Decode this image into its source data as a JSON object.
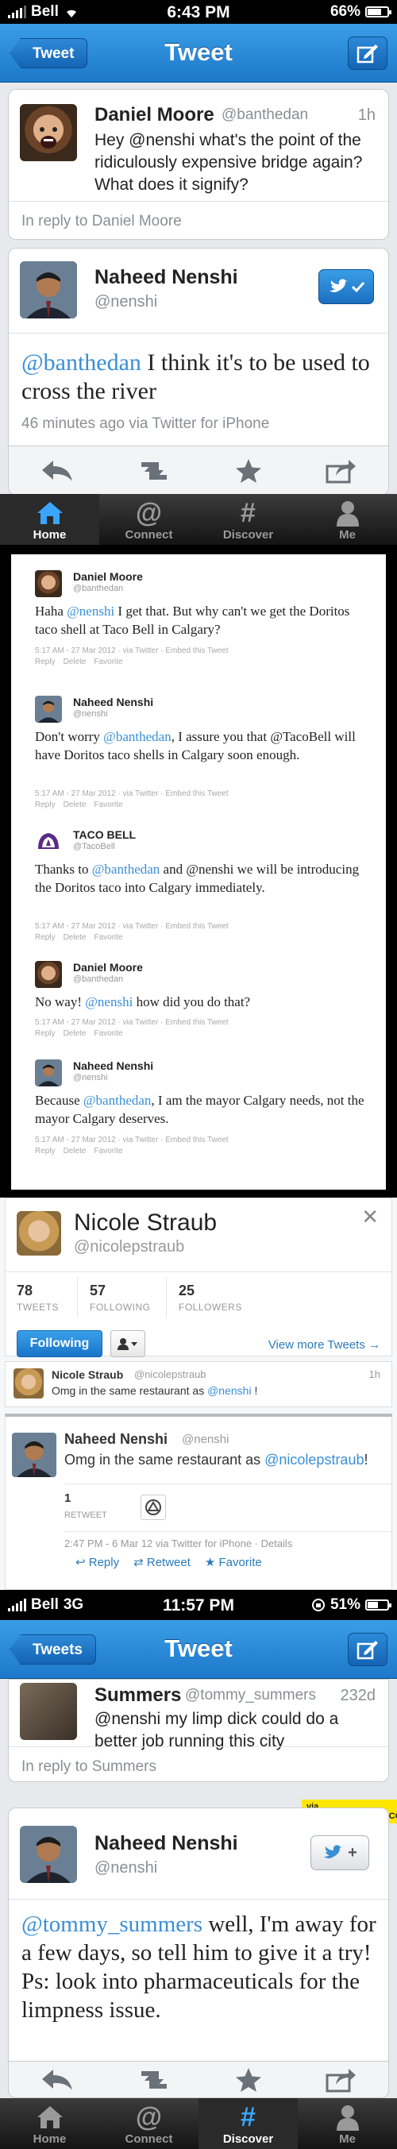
{
  "panel1": {
    "status": {
      "carrier": "Bell",
      "time": "6:43 PM",
      "battery": "66%"
    },
    "nav": {
      "back": "Tweet",
      "title": "Tweet"
    },
    "original": {
      "name": "Daniel Moore",
      "handle": "@banthedan",
      "age": "1h",
      "text": "Hey @nenshi what's the point of the ridiculously expensive bridge again? What does it signify?",
      "in_reply_to": "In reply to Daniel Moore"
    },
    "reply": {
      "name": "Naheed Nenshi",
      "handle": "@nenshi",
      "mention": "@banthedan",
      "text": " I think it's to be used to cross the river",
      "meta": "46 minutes ago via Twitter for iPhone"
    },
    "tabs": [
      {
        "label": "Home",
        "icon": "home-icon"
      },
      {
        "label": "Connect",
        "icon": "at-icon"
      },
      {
        "label": "Discover",
        "icon": "hash-icon"
      },
      {
        "label": "Me",
        "icon": "person-icon"
      }
    ]
  },
  "panel2": {
    "tweets": [
      {
        "name": "Daniel Moore",
        "handle": "@banthedan",
        "pre": "Haha ",
        "mention": "@nenshi",
        "post": " I get that. But why can't we get the Doritos taco shell at Taco Bell in Calgary?",
        "meta": "5:17 AM - 27 Mar 2012 · via Twitter · Embed this Tweet",
        "actions": [
          "Reply",
          "Delete",
          "Favorite"
        ]
      },
      {
        "name": "Naheed Nenshi",
        "handle": "@nenshi",
        "pre": "Don't worry ",
        "mention": "@banthedan",
        "post": ", I assure you that @TacoBell will have Doritos taco shells in Calgary soon enough.",
        "meta": "5:17 AM - 27 Mar 2012 · via Twitter · Embed this Tweet",
        "actions": [
          "Reply",
          "Delete",
          "Favorite"
        ]
      },
      {
        "name": "TACO BELL",
        "handle": "@TacoBell",
        "pre": "Thanks to ",
        "mention": "@banthedan",
        "post": " and @nenshi we will be introducing the Doritos taco into Calgary immediately.",
        "meta": "5:17 AM - 27 Mar 2012 · via Twitter · Embed this Tweet",
        "actions": [
          "Reply",
          "Delete",
          "Favorite"
        ]
      },
      {
        "name": "Daniel Moore",
        "handle": "@banthedan",
        "pre": "No way! ",
        "mention": "@nenshi",
        "post": " how did you do that?",
        "meta": "5:17 AM - 27 Mar 2012 · via Twitter · Embed this Tweet",
        "actions": [
          "Reply",
          "Delete",
          "Favorite"
        ]
      },
      {
        "name": "Naheed Nenshi",
        "handle": "@nenshi",
        "pre": "Because ",
        "mention": "@banthedan",
        "post": ", I am the mayor Calgary needs, not the mayor Calgary deserves.",
        "meta": "5:17 AM - 27 Mar 2012 · via Twitter · Embed this Tweet",
        "actions": [
          "Reply",
          "Delete",
          "Favorite"
        ]
      }
    ]
  },
  "panel3": {
    "name": "Nicole Straub",
    "handle": "@nicolepstraub",
    "stats": [
      {
        "n": "78",
        "label": "TWEETS"
      },
      {
        "n": "57",
        "label": "FOLLOWING"
      },
      {
        "n": "25",
        "label": "FOLLOWERS"
      }
    ],
    "following_label": "Following",
    "view_more": "View more Tweets →",
    "tweet1": {
      "name": "Nicole Straub",
      "handle": "@nicolepstraub",
      "age": "1h",
      "pre": "Omg in the same restaurant as ",
      "mention": "@nenshi",
      "post": " !"
    },
    "tweet2": {
      "name": "Naheed Nenshi",
      "handle": "@nenshi",
      "pre": "Omg in the same restaurant as ",
      "mention": "@nicolepstraub",
      "post": "!",
      "retweets": "1",
      "retweet_label": "RETWEET",
      "meta": "2:47 PM - 6 Mar 12 via Twitter for iPhone · Details",
      "actions": [
        "Reply",
        "Retweet",
        "Favorite"
      ]
    }
  },
  "panel4": {
    "status": {
      "carrier": "Bell",
      "network": "3G",
      "time": "11:57 PM",
      "battery": "51%"
    },
    "nav": {
      "back": "Tweets",
      "title": "Tweet"
    },
    "original": {
      "name": "Summers",
      "handle": "@tommy_summers",
      "age": "232d",
      "text": "@nenshi my limp dick could do a better job running this city",
      "in_reply_to": "In reply to Summers"
    },
    "reply": {
      "name": "Naheed Nenshi",
      "handle": "@nenshi",
      "mention": "@tommy_summers",
      "text": " well, I'm away for a few days, so tell him to give it a try! Ps: look into pharmaceuticals for the limpness issue."
    },
    "watermark": "via THEMETAPICTURE.COM",
    "tabs": [
      {
        "label": "Home",
        "icon": "home-icon"
      },
      {
        "label": "Connect",
        "icon": "at-icon"
      },
      {
        "label": "Discover",
        "icon": "hash-icon"
      },
      {
        "label": "Me",
        "icon": "person-icon"
      }
    ]
  },
  "colors": {
    "twitter_blue": "#1d78c9",
    "link": "#3a8fd6",
    "taco_bell_purple": "#5b2a86"
  }
}
